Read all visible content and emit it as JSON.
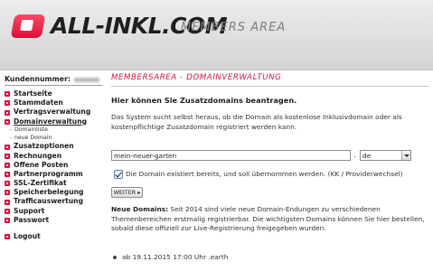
{
  "header": {
    "logo_text": "ALL-INKL.COM",
    "logo_sub": "MEMBERS AREA"
  },
  "sidebar": {
    "kundennummer_label": "Kundennummer:",
    "items": [
      {
        "label": "Startseite"
      },
      {
        "label": "Stammdaten"
      },
      {
        "label": "Vertragsverwaltung"
      },
      {
        "label": "Domainverwaltung",
        "active": true
      },
      {
        "label": "Domainliste",
        "sub": true
      },
      {
        "label": "neue Domain",
        "sub": true
      },
      {
        "label": "Zusatzoptionen"
      },
      {
        "label": "Rechnungen"
      },
      {
        "label": "Offene Posten"
      },
      {
        "label": "Partnerprogramm"
      },
      {
        "label": "SSL-Zertifikat"
      },
      {
        "label": "Speicherbelegung"
      },
      {
        "label": "Trafficauswertung"
      },
      {
        "label": "Support"
      },
      {
        "label": "Passwort"
      },
      {
        "label": "Logout"
      }
    ]
  },
  "main": {
    "section_title": "MEMBERSAREA - DOMAINVERWALTUNG",
    "heading": "Hier können Sie Zusatzdomains beantragen.",
    "intro": "Das System sucht selbst heraus, ob die Domain als kostenlose Inklusivdomain oder als kostenpflichtige Zusatzdomain registriert werden kann.",
    "domain_input_value": "mein-neuer-garten",
    "dot": ".",
    "tld_selected": "de",
    "checkbox_label": "Die Domain existiert bereits, und soll übernommen werden. (KK / Providerwechsel)",
    "checkbox_checked": true,
    "weiter_label": "WEITER ▸",
    "news_title": "Neue Domains:",
    "news_text": " Seit 2014 sind viele neue Domain-Endungen zu verschiedenen Themenbereichen erstmalig registrierbar. Die wichtigsten Domains können Sie hier bestellen, sobald diese offiziell zur Live-Registrierung freigegeben wurden.",
    "launch_text": "ab 19.11.2015 17:00 Uhr .earth"
  },
  "colors": {
    "accent": "#d4143c",
    "header_bg": "#dddddd"
  }
}
